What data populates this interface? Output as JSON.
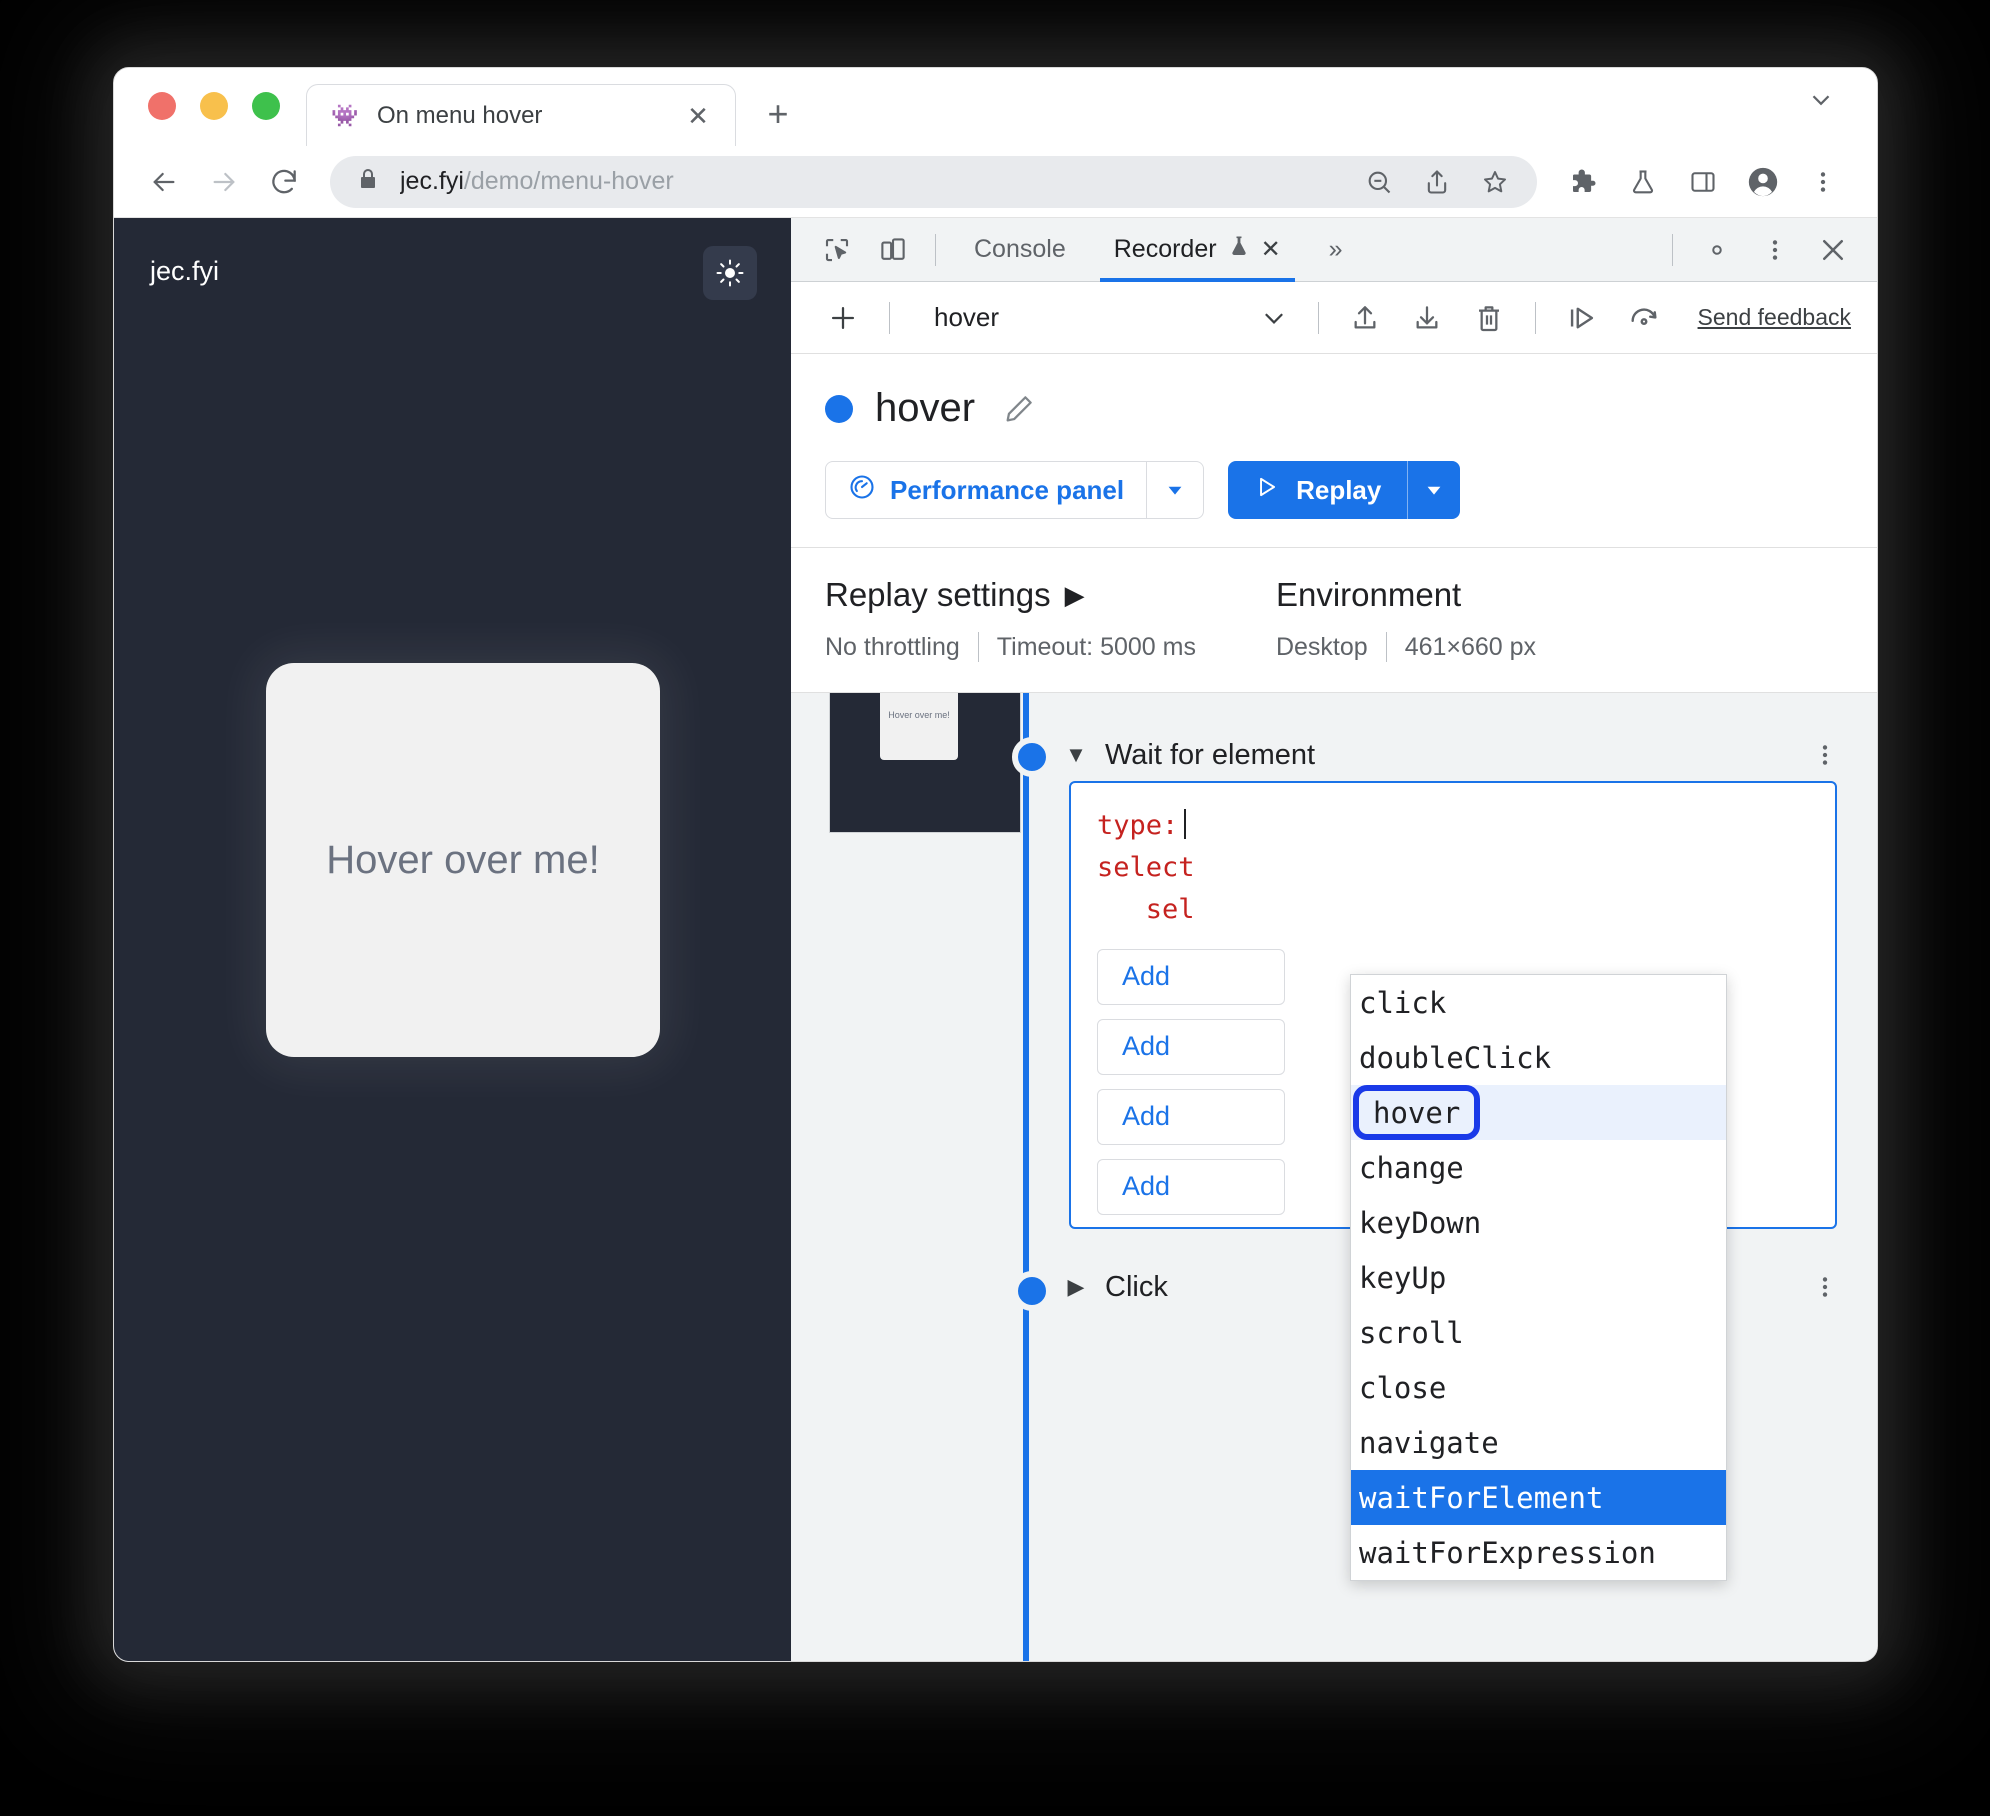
{
  "browser": {
    "tab": {
      "title": "On menu hover",
      "favicon": "alien-monster-favicon",
      "close": "✕"
    },
    "newtab_label": "+",
    "tabstrip_more": "chevron-down-icon",
    "omnibox": {
      "url_host": "jec.fyi",
      "url_path": "/demo/menu-hover",
      "lock": "lock-icon"
    },
    "toolbar_icons": [
      "back-icon",
      "forward-icon",
      "reload-icon",
      "zoom-out-icon",
      "share-icon",
      "bookmark-star-icon",
      "extensions-icon",
      "devtools-flask-icon",
      "side-panel-icon",
      "profile-avatar-icon",
      "more-menu-icon"
    ]
  },
  "page": {
    "site_name": "jec.fyi",
    "theme_toggle": "sun-icon",
    "card_label": "Hover over me!"
  },
  "devtools": {
    "tabbar": {
      "inspect_icon": "inspect-element-icon",
      "device_icon": "device-toolbar-icon",
      "tabs": [
        {
          "label": "Console",
          "active": false
        },
        {
          "label": "Recorder",
          "active": true,
          "badge": "experiment-flask-icon",
          "close": "✕"
        }
      ],
      "more_tabs": "»",
      "settings_icon": "gear-icon",
      "kebab_icon": "more-options-icon",
      "close_icon": "close-devtools-icon"
    },
    "recorder_toolbar": {
      "add_label": "+",
      "recording_name": "hover",
      "select_chevron": "chevron-down-icon",
      "export_icon": "export-icon",
      "import_icon": "import-icon",
      "delete_icon": "delete-icon",
      "step_replay_icon": "step-replay-icon",
      "replay_speed_icon": "replay-speed-icon",
      "feedback_label": "Send feedback"
    },
    "header": {
      "status_dot": "blue-status-dot",
      "title": "hover",
      "edit_icon": "pencil-edit-icon",
      "perf_button": {
        "label": "Performance panel",
        "icon": "performance-gauge-icon",
        "caret": "▼"
      },
      "replay_button": {
        "label": "Replay",
        "icon": "▷",
        "caret": "▼"
      }
    },
    "settings": {
      "replay": {
        "heading": "Replay settings",
        "expand_caret": "▶",
        "throttling": "No throttling",
        "timeout": "Timeout: 5000 ms"
      },
      "environment": {
        "heading": "Environment",
        "device": "Desktop",
        "viewport": "461×660 px"
      }
    },
    "steps": [
      {
        "label": "Wait for element",
        "caret": "▼",
        "kebab": "more-options-icon",
        "thumbnail_label": "Hover over me!"
      },
      {
        "label": "Click",
        "caret": "▶",
        "kebab": "more-options-icon"
      }
    ],
    "step_editor": {
      "line1_key": "type:",
      "line1_value": "",
      "line2_key": "select",
      "line3_key": "sel",
      "add_buttons": [
        "Add",
        "Add",
        "Add",
        "Add"
      ]
    },
    "autocomplete": {
      "items": [
        {
          "label": "click",
          "state": "normal"
        },
        {
          "label": "doubleClick",
          "state": "normal"
        },
        {
          "label": "hover",
          "state": "ringed"
        },
        {
          "label": "change",
          "state": "normal"
        },
        {
          "label": "keyDown",
          "state": "normal"
        },
        {
          "label": "keyUp",
          "state": "normal"
        },
        {
          "label": "scroll",
          "state": "normal"
        },
        {
          "label": "close",
          "state": "normal"
        },
        {
          "label": "navigate",
          "state": "normal"
        },
        {
          "label": "waitForElement",
          "state": "selected"
        },
        {
          "label": "waitForExpression",
          "state": "normal"
        }
      ]
    }
  },
  "colors": {
    "accent": "#1a73e8",
    "ring": "#1a3ae8",
    "page_bg": "#242936",
    "panel_bg": "#f1f3f4",
    "code_red": "#c5221f"
  }
}
